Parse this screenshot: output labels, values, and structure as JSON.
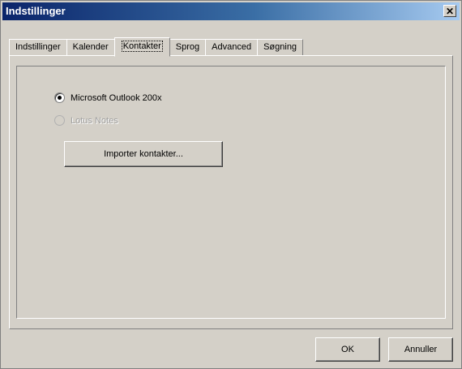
{
  "window": {
    "title": "Indstillinger"
  },
  "tabs": [
    {
      "label": "Indstillinger",
      "active": false
    },
    {
      "label": "Kalender",
      "active": false
    },
    {
      "label": "Kontakter",
      "active": true
    },
    {
      "label": "Sprog",
      "active": false
    },
    {
      "label": "Advanced",
      "active": false
    },
    {
      "label": "Søgning",
      "active": false
    }
  ],
  "contacts": {
    "options": [
      {
        "label": "Microsoft Outlook 200x",
        "checked": true,
        "enabled": true
      },
      {
        "label": "Lotus Notes",
        "checked": false,
        "enabled": false
      }
    ],
    "import_button": "Importer kontakter..."
  },
  "footer": {
    "ok_label": "OK",
    "cancel_label": "Annuller"
  }
}
